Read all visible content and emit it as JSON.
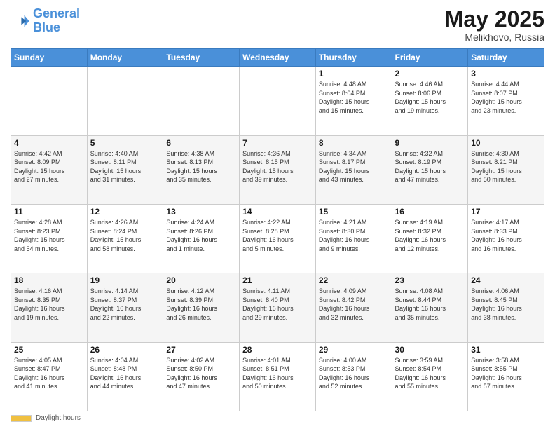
{
  "header": {
    "logo_general": "General",
    "logo_blue": "Blue",
    "month": "May 2025",
    "location": "Melikhovo, Russia"
  },
  "footer": {
    "label": "Daylight hours"
  },
  "weekdays": [
    "Sunday",
    "Monday",
    "Tuesday",
    "Wednesday",
    "Thursday",
    "Friday",
    "Saturday"
  ],
  "weeks": [
    [
      {
        "day": "",
        "info": ""
      },
      {
        "day": "",
        "info": ""
      },
      {
        "day": "",
        "info": ""
      },
      {
        "day": "",
        "info": ""
      },
      {
        "day": "1",
        "info": "Sunrise: 4:48 AM\nSunset: 8:04 PM\nDaylight: 15 hours\nand 15 minutes."
      },
      {
        "day": "2",
        "info": "Sunrise: 4:46 AM\nSunset: 8:06 PM\nDaylight: 15 hours\nand 19 minutes."
      },
      {
        "day": "3",
        "info": "Sunrise: 4:44 AM\nSunset: 8:07 PM\nDaylight: 15 hours\nand 23 minutes."
      }
    ],
    [
      {
        "day": "4",
        "info": "Sunrise: 4:42 AM\nSunset: 8:09 PM\nDaylight: 15 hours\nand 27 minutes."
      },
      {
        "day": "5",
        "info": "Sunrise: 4:40 AM\nSunset: 8:11 PM\nDaylight: 15 hours\nand 31 minutes."
      },
      {
        "day": "6",
        "info": "Sunrise: 4:38 AM\nSunset: 8:13 PM\nDaylight: 15 hours\nand 35 minutes."
      },
      {
        "day": "7",
        "info": "Sunrise: 4:36 AM\nSunset: 8:15 PM\nDaylight: 15 hours\nand 39 minutes."
      },
      {
        "day": "8",
        "info": "Sunrise: 4:34 AM\nSunset: 8:17 PM\nDaylight: 15 hours\nand 43 minutes."
      },
      {
        "day": "9",
        "info": "Sunrise: 4:32 AM\nSunset: 8:19 PM\nDaylight: 15 hours\nand 47 minutes."
      },
      {
        "day": "10",
        "info": "Sunrise: 4:30 AM\nSunset: 8:21 PM\nDaylight: 15 hours\nand 50 minutes."
      }
    ],
    [
      {
        "day": "11",
        "info": "Sunrise: 4:28 AM\nSunset: 8:23 PM\nDaylight: 15 hours\nand 54 minutes."
      },
      {
        "day": "12",
        "info": "Sunrise: 4:26 AM\nSunset: 8:24 PM\nDaylight: 15 hours\nand 58 minutes."
      },
      {
        "day": "13",
        "info": "Sunrise: 4:24 AM\nSunset: 8:26 PM\nDaylight: 16 hours\nand 1 minute."
      },
      {
        "day": "14",
        "info": "Sunrise: 4:22 AM\nSunset: 8:28 PM\nDaylight: 16 hours\nand 5 minutes."
      },
      {
        "day": "15",
        "info": "Sunrise: 4:21 AM\nSunset: 8:30 PM\nDaylight: 16 hours\nand 9 minutes."
      },
      {
        "day": "16",
        "info": "Sunrise: 4:19 AM\nSunset: 8:32 PM\nDaylight: 16 hours\nand 12 minutes."
      },
      {
        "day": "17",
        "info": "Sunrise: 4:17 AM\nSunset: 8:33 PM\nDaylight: 16 hours\nand 16 minutes."
      }
    ],
    [
      {
        "day": "18",
        "info": "Sunrise: 4:16 AM\nSunset: 8:35 PM\nDaylight: 16 hours\nand 19 minutes."
      },
      {
        "day": "19",
        "info": "Sunrise: 4:14 AM\nSunset: 8:37 PM\nDaylight: 16 hours\nand 22 minutes."
      },
      {
        "day": "20",
        "info": "Sunrise: 4:12 AM\nSunset: 8:39 PM\nDaylight: 16 hours\nand 26 minutes."
      },
      {
        "day": "21",
        "info": "Sunrise: 4:11 AM\nSunset: 8:40 PM\nDaylight: 16 hours\nand 29 minutes."
      },
      {
        "day": "22",
        "info": "Sunrise: 4:09 AM\nSunset: 8:42 PM\nDaylight: 16 hours\nand 32 minutes."
      },
      {
        "day": "23",
        "info": "Sunrise: 4:08 AM\nSunset: 8:44 PM\nDaylight: 16 hours\nand 35 minutes."
      },
      {
        "day": "24",
        "info": "Sunrise: 4:06 AM\nSunset: 8:45 PM\nDaylight: 16 hours\nand 38 minutes."
      }
    ],
    [
      {
        "day": "25",
        "info": "Sunrise: 4:05 AM\nSunset: 8:47 PM\nDaylight: 16 hours\nand 41 minutes."
      },
      {
        "day": "26",
        "info": "Sunrise: 4:04 AM\nSunset: 8:48 PM\nDaylight: 16 hours\nand 44 minutes."
      },
      {
        "day": "27",
        "info": "Sunrise: 4:02 AM\nSunset: 8:50 PM\nDaylight: 16 hours\nand 47 minutes."
      },
      {
        "day": "28",
        "info": "Sunrise: 4:01 AM\nSunset: 8:51 PM\nDaylight: 16 hours\nand 50 minutes."
      },
      {
        "day": "29",
        "info": "Sunrise: 4:00 AM\nSunset: 8:53 PM\nDaylight: 16 hours\nand 52 minutes."
      },
      {
        "day": "30",
        "info": "Sunrise: 3:59 AM\nSunset: 8:54 PM\nDaylight: 16 hours\nand 55 minutes."
      },
      {
        "day": "31",
        "info": "Sunrise: 3:58 AM\nSunset: 8:55 PM\nDaylight: 16 hours\nand 57 minutes."
      }
    ]
  ]
}
